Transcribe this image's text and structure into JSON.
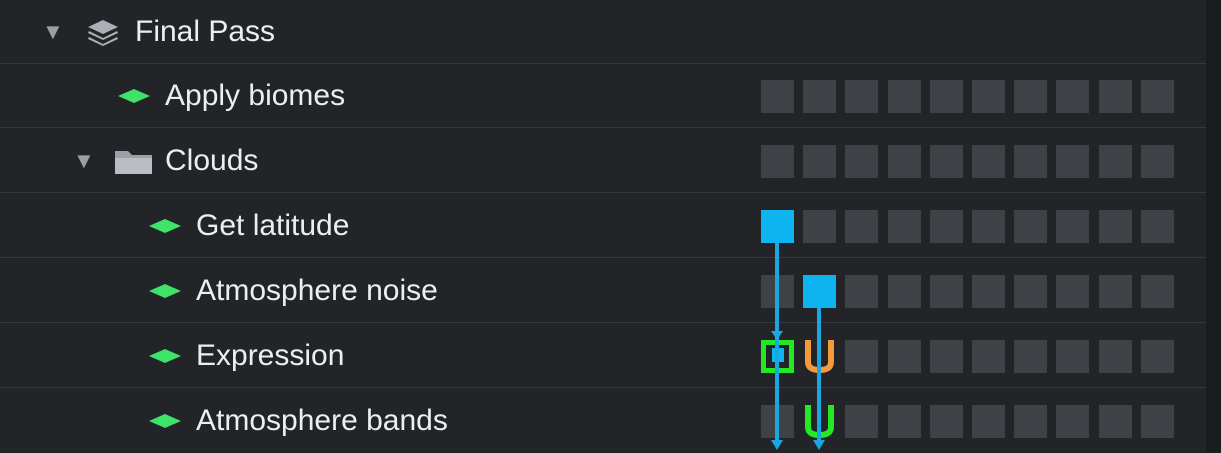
{
  "tree": {
    "rows": [
      {
        "label": "Final Pass",
        "kind": "group",
        "expanded": true,
        "icon": "layers-icon"
      },
      {
        "label": "Apply biomes",
        "kind": "node",
        "icon": "diamond-icon"
      },
      {
        "label": "Clouds",
        "kind": "folder",
        "expanded": true,
        "icon": "folder-icon"
      },
      {
        "label": "Get latitude",
        "kind": "node",
        "icon": "diamond-icon"
      },
      {
        "label": "Atmosphere noise",
        "kind": "node",
        "icon": "diamond-icon"
      },
      {
        "label": "Expression",
        "kind": "node",
        "icon": "diamond-icon"
      },
      {
        "label": "Atmosphere bands",
        "kind": "node",
        "icon": "diamond-icon"
      }
    ],
    "expand_arrow": "▼"
  },
  "colors": {
    "background": "#222427",
    "node_diamond": "#3fe36a",
    "slot_empty": "#3e4246",
    "output_blue": "#0db4f0",
    "input_green": "#23e823",
    "input_orange": "#f39a3a",
    "wire": "#1aa6e0"
  },
  "slots_per_row": 10
}
